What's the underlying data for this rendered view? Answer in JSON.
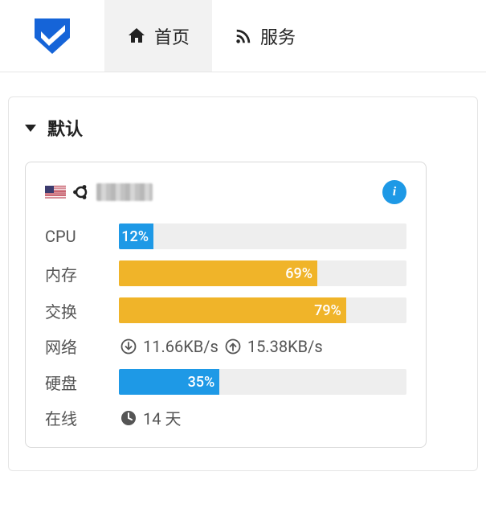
{
  "nav": {
    "home_label": "首页",
    "service_label": "服务"
  },
  "panel": {
    "title": "默认"
  },
  "card": {
    "info_glyph": "i",
    "stats": {
      "cpu": {
        "label": "CPU",
        "value": 12,
        "display": "12%",
        "color": "blue"
      },
      "memory": {
        "label": "内存",
        "value": 69,
        "display": "69%",
        "color": "yellow"
      },
      "swap": {
        "label": "交换",
        "value": 79,
        "display": "79%",
        "color": "yellow"
      },
      "network": {
        "label": "网络",
        "down": "11.66KB/s",
        "up": "15.38KB/s"
      },
      "disk": {
        "label": "硬盘",
        "value": 35,
        "display": "35%",
        "color": "blue"
      },
      "uptime": {
        "label": "在线",
        "value": "14 天"
      }
    }
  }
}
